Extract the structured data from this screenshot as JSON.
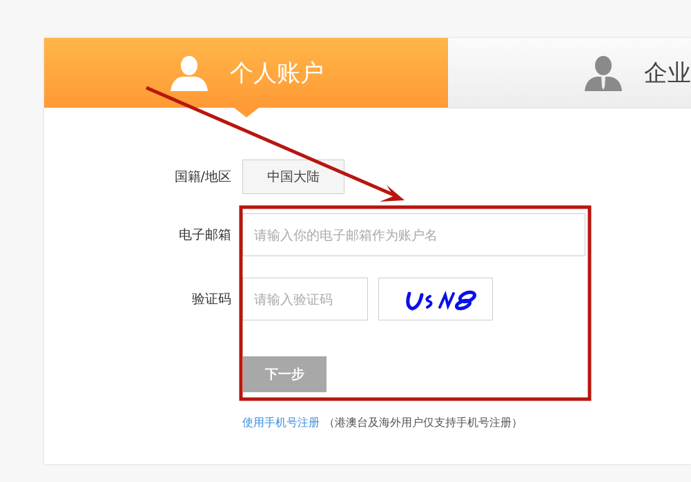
{
  "tabs": [
    {
      "label": "个人账户",
      "selected": true
    },
    {
      "label": "企业",
      "selected": false
    }
  ],
  "form": {
    "region": {
      "label": "国籍/地区",
      "value": "中国大陆"
    },
    "email": {
      "label": "电子邮箱",
      "placeholder": "请输入你的电子邮箱作为账户名"
    },
    "captcha": {
      "label": "验证码",
      "placeholder": "请输入验证码"
    },
    "next_button": {
      "label": "下一步",
      "disabled": true
    }
  },
  "footer": {
    "link": "使用手机号注册",
    "note": "（港澳台及海外用户仅支持手机号注册）"
  }
}
